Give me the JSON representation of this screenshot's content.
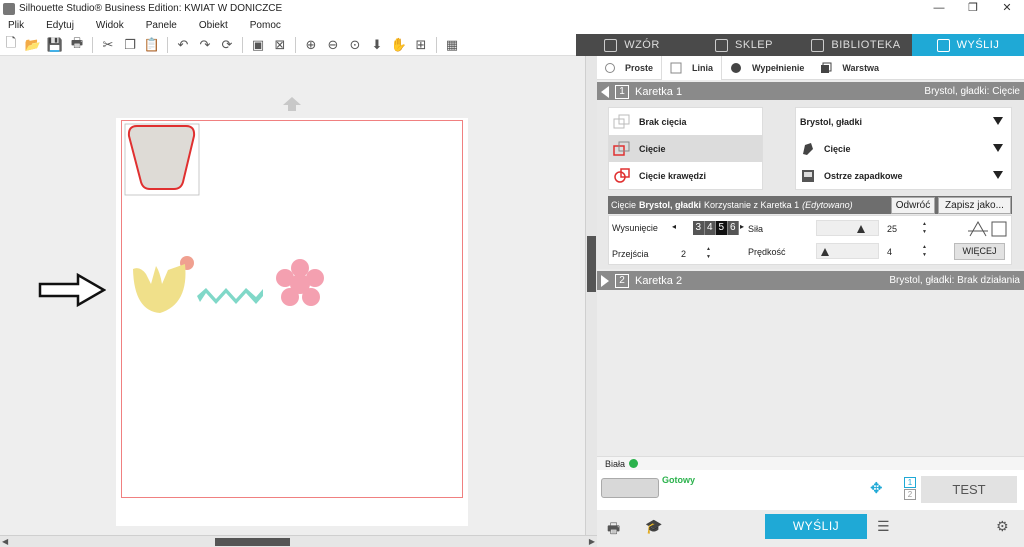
{
  "window": {
    "title": "Silhouette Studio® Business Edition: KWIAT W DONICZCE",
    "minimize": "—",
    "maximize": "❐",
    "close": "✕"
  },
  "menu": [
    "Plik",
    "Edytuj",
    "Widok",
    "Panele",
    "Obiekt",
    "Pomoc"
  ],
  "toolbar_icons": [
    "new-icon",
    "open-icon",
    "save-icon",
    "print-icon",
    "cut-icon",
    "copy-icon",
    "paste-icon",
    "undo-icon",
    "redo-icon",
    "refresh-icon",
    "group-icon",
    "ungroup-icon",
    "zoom-in-icon",
    "zoom-out-icon",
    "zoom-fit-icon",
    "move-down-icon",
    "pan-hand-icon",
    "add-page-icon",
    "pattern-icon"
  ],
  "tabs": [
    {
      "label": "WZÓR",
      "icon": "grid-icon",
      "active": false
    },
    {
      "label": "SKLEP",
      "icon": "shop-icon",
      "active": false
    },
    {
      "label": "BIBLIOTEKA",
      "icon": "library-icon",
      "active": false
    },
    {
      "label": "WYŚLIJ",
      "icon": "send-icon",
      "active": true
    }
  ],
  "modes": [
    "Proste",
    "Linia",
    "Wypełnienie",
    "Warstwa"
  ],
  "karetka1": {
    "num": "1",
    "label": "Karetka 1",
    "summary": "Brystol, gładki: Cięcie",
    "actions": [
      "Brak cięcia",
      "Cięcie",
      "Cięcie krawędzi"
    ],
    "selected_action": "Cięcie",
    "material": "Brystol, gładki",
    "action_select": "Cięcie",
    "tool": "Ostrze zapadkowe",
    "info_prefix": "Cięcie",
    "info_material": "Brystol, gładki",
    "info_mid": "Korzystanie z Karetka 1",
    "info_edited": "(Edytowano)",
    "btn_reverse": "Odwróć",
    "btn_save": "Zapisz jako...",
    "blade_label": "Wysunięcie ostrza",
    "blade_digits": [
      "3",
      "4",
      "5",
      "6"
    ],
    "passes_label": "Przejścia",
    "passes": "2",
    "force_label": "Siła",
    "force": "25",
    "speed_label": "Prędkość",
    "speed": "4",
    "btn_more": "WIĘCEJ"
  },
  "karetka2": {
    "num": "2",
    "label": "Karetka 2",
    "summary": "Brystol, gładki: Brak działania"
  },
  "device": {
    "name": "Biała",
    "status": "Gotowy",
    "carriage_1": "1",
    "carriage_2": "2",
    "btn_test": "TEST"
  },
  "btn_send": "WYŚLIJ",
  "colors": {
    "accent": "#1fa9d6",
    "cut_line": "#e03030",
    "flower": "#f4a0b0",
    "zigzag": "#80d8c8",
    "tulip": "#f0e08a",
    "dot": "#f0a090",
    "pot": "#dedbd6"
  }
}
